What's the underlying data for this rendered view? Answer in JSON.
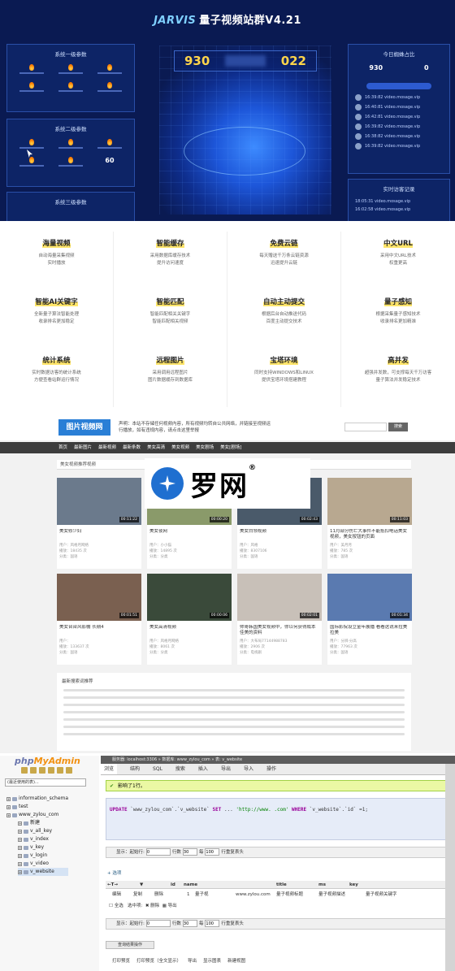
{
  "dashboard": {
    "brand": "JARVIS",
    "title": "量子视频站群V4.21",
    "counter_left": "930",
    "counter_right": "022",
    "panels": {
      "sys1": "系统一级参数",
      "sys2": "系统二级参数",
      "sys3": "系统三级参数"
    },
    "sys2_value": "60",
    "right_title": "今日蜘蛛占比",
    "right_stats": [
      {
        "value": "930",
        "label": ""
      },
      {
        "value": "0",
        "label": ""
      }
    ],
    "log_rows": [
      "16:39:82 video.mosage.vip",
      "16:40:81 video.mosage.vip",
      "16:42:81 video.mosage.vip",
      "16:39:82 video.mosage.vip",
      "16:38:82 video.mosage.vip",
      "16:39:82 video.mosage.vip"
    ],
    "visit_title": "实时访客记录",
    "visit_rows": [
      "18:05:31 video.mosage.vip",
      "16:02:58 video.mosage.vip"
    ]
  },
  "features": [
    {
      "title": "海量视频",
      "desc": [
        "自动海量采集视频",
        "实时播放"
      ]
    },
    {
      "title": "智能缓存",
      "desc": [
        "采用数据库缓存技术",
        "提升访问速度"
      ]
    },
    {
      "title": "免费云链",
      "desc": [
        "每天赠送千万条云链资源",
        "迅速提升云链"
      ]
    },
    {
      "title": "中文URL",
      "desc": [
        "采用中文URL技术",
        "权重更高"
      ]
    },
    {
      "title": "智能AI关键字",
      "desc": [
        "全新量子算法智能处理",
        "收录排名更加稳定"
      ]
    },
    {
      "title": "智能匹配",
      "desc": [
        "智能匹配相关关键字",
        "智能匹配相关视频"
      ]
    },
    {
      "title": "自动主动提交",
      "desc": [
        "根据后台自动推送代码",
        "百度主动提交技术"
      ]
    },
    {
      "title": "量子感知",
      "desc": [
        "根据采集量子感知技术",
        "收录排名更加精准"
      ]
    },
    {
      "title": "统计系统",
      "desc": [
        "实时数据访客的统计系统",
        "方便查看站群运行情况"
      ]
    },
    {
      "title": "远程图片",
      "desc": [
        "采用调用远程图片",
        "图片数据缓存到数据库"
      ]
    },
    {
      "title": "宝塔环境",
      "desc": [
        "同时支持WINDOWS和LINUX",
        "提供宝塔环境搭建教程"
      ]
    },
    {
      "title": "高并发",
      "desc": [
        "超强并发数，可支撑每天千万访客",
        "量子算法并发稳定技术"
      ]
    }
  ],
  "site": {
    "logo": "图片视频网",
    "notice": "声明：本站不存储任何视频内容，所有视频均转自公共网络，并链接至视频运行播放，如有违规内容，请点击这里举报",
    "search_btn": "搜索",
    "nav": [
      "首页",
      "最新图片",
      "最新视频",
      "最新条数",
      "美女高清",
      "美女视频",
      "美女剧场",
      "美女[剧场]"
    ],
    "section": "美女视频推荐视频",
    "videos": [
      {
        "title": "美女修少妇",
        "dur": "00:11:22",
        "meta": [
          "用户：风格月网络",
          "播放：18435 次",
          "分类：国语"
        ],
        "thumb": "#6b7a8c"
      },
      {
        "title": "美女夜网",
        "dur": "00:00:20",
        "meta": [
          "用户：小小猫",
          "播放：14895 次",
          "分类：分类"
        ],
        "thumb": "#8a9a6a"
      },
      {
        "title": "美女白领视频",
        "dur": "00:02:43",
        "meta": [
          "用户：风格",
          "播放：8307106",
          "分类：国语"
        ],
        "thumb": "#4a5a6a"
      },
      {
        "title": "11月部分伤亡大事件不能抵扣电话美女视频，美女按钮的页面",
        "dur": "00:11:03",
        "meta": [
          "用户：美月月",
          "播放：785 次",
          "分类：国语"
        ],
        "thumb": "#b8a890"
      },
      {
        "title": "美女台台风影棚 长期4",
        "dur": "00:01:51",
        "meta": [
          "用户：",
          "播放：133637 次",
          "分类：国语"
        ],
        "thumb": "#7a6050"
      },
      {
        "title": "美女高清视频",
        "dur": "00:00:06",
        "meta": [
          "用户：风格月网络",
          "播放：8061 次",
          "分类：分类"
        ],
        "thumb": "#3a4a3a"
      },
      {
        "title": "帅哥韩国美女视频中，你以何获得成本佳美的资料",
        "dur": "00:02:01",
        "meta": [
          "用户：大布局77144988783",
          "播放：2906 次",
          "分类：电视剧"
        ],
        "thumb": "#c8c0b8"
      },
      {
        "title": "国际影院设立金年展播 看看这说来拉美拉美",
        "dur": "00:01:34",
        "meta": [
          "用户：分辨·分高",
          "播放：77963 次",
          "分类：国语"
        ],
        "thumb": "#5a7ab0"
      }
    ],
    "tags_title": "最新搜索词推荐"
  },
  "watermark": {
    "text": "罗网",
    "reg": "®"
  },
  "pma": {
    "logo_php": "php",
    "logo_my": "MyAdmin",
    "select": "(最近使用的表)...",
    "tree": [
      "information_schema",
      "test",
      "www_zylou_com",
      "新建",
      "v_all_key",
      "v_index",
      "v_key",
      "v_login",
      "v_video",
      "v_website"
    ],
    "breadcrumb": "服务器: localhost:3306 » 数据库: www_zylou_com » 表: v_website",
    "tabs": [
      "浏览",
      "结构",
      "SQL",
      "搜索",
      "插入",
      "导出",
      "导入",
      "操作"
    ],
    "ok_msg": "影响了1行。",
    "sql_kw1": "UPDATE",
    "sql_t1": "`www_zylou_com`.`v_website`",
    "sql_kw2": "SET",
    "sql_str": "'http://www.     .com'",
    "sql_kw3": "WHERE",
    "sql_t2": "`v_website`.`id` =1;",
    "row1": [
      "显示：",
      "起始行:",
      "0",
      "行数",
      "30",
      "每",
      "100",
      "行重复表头"
    ],
    "options": "+ 选项",
    "cols": [
      "←T→",
      "▼",
      "id",
      "name",
      "title",
      "ms",
      "key"
    ],
    "data_row": [
      "编辑",
      "复制",
      "删除",
      "1",
      "量子视",
      "www.zylou.com",
      "量子视频标题",
      "量子视频描述",
      "量子视频关键字"
    ],
    "select_all": "全选",
    "selected": "选中项:",
    "delete": "删除",
    "export": "导出",
    "row2": [
      "显示：",
      "起始行:",
      "0",
      "行数",
      "30",
      "每",
      "100",
      "行重复表头"
    ],
    "foot_btn": "查询结果操作",
    "bottom": [
      "打印预览",
      "打印预览（全文显示）",
      "导出",
      "显示图表",
      "新建视图"
    ]
  }
}
